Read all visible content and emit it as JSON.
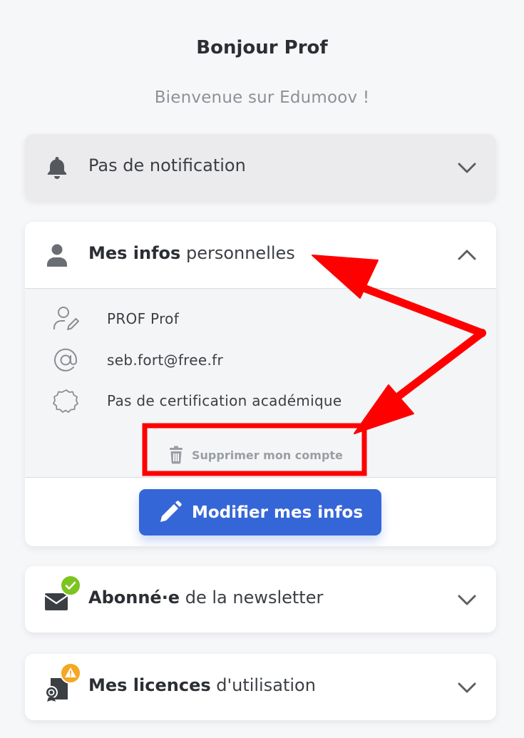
{
  "header": {
    "greeting": "Bonjour Prof",
    "welcome": "Bienvenue sur Edumoov !"
  },
  "notifications": {
    "title": "Pas de notification",
    "icon": "bell-icon",
    "expanded": false
  },
  "personal_info": {
    "title_bold": "Mes infos",
    "title_rest": " personnelles",
    "icon": "user-icon",
    "expanded": true,
    "name": "PROF Prof",
    "email": "seb.fort@free.fr",
    "certification": "Pas de certification académique",
    "delete_label": "Supprimer mon compte",
    "edit_label": "Modifier mes infos"
  },
  "newsletter": {
    "title_bold": "Abonné·e",
    "title_rest": " de la newsletter",
    "icon": "envelope-icon",
    "badge": "check-badge-icon",
    "expanded": false
  },
  "licences": {
    "title_bold": "Mes licences",
    "title_rest": " d'utilisation",
    "icon": "license-icon",
    "badge": "warning-badge-icon",
    "expanded": false
  },
  "colors": {
    "primary_button": "#3566d8",
    "annotation_red": "#ff0000",
    "success_badge": "#7cc41f",
    "warning_badge": "#f5a623"
  }
}
